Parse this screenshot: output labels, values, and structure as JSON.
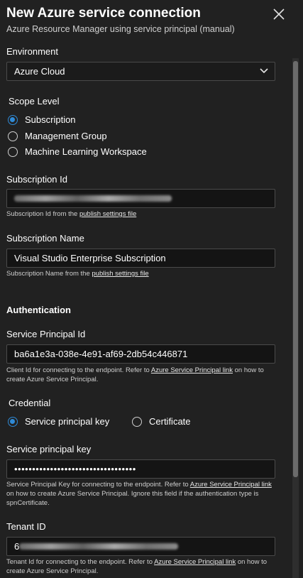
{
  "header": {
    "title": "New Azure service connection",
    "subtitle": "Azure Resource Manager using service principal (manual)"
  },
  "environment": {
    "label": "Environment",
    "value": "Azure Cloud"
  },
  "scope": {
    "label": "Scope Level",
    "options": [
      "Subscription",
      "Management Group",
      "Machine Learning Workspace"
    ],
    "selected": "Subscription"
  },
  "subscription_id": {
    "label": "Subscription Id",
    "help_prefix": "Subscription Id from the ",
    "help_link": "publish settings file"
  },
  "subscription_name": {
    "label": "Subscription Name",
    "value": "Visual Studio Enterprise Subscription",
    "help_prefix": "Subscription Name from the ",
    "help_link": "publish settings file"
  },
  "authentication": {
    "heading": "Authentication"
  },
  "service_principal_id": {
    "label": "Service Principal Id",
    "value": "ba6a1e3a-038e-4e91-af69-2db54c446871",
    "help_prefix": "Client Id for connecting to the endpoint. Refer to ",
    "help_link": "Azure Service Principal link",
    "help_suffix": " on how to create Azure Service Principal."
  },
  "credential": {
    "label": "Credential",
    "options": [
      "Service principal key",
      "Certificate"
    ],
    "selected": "Service principal key"
  },
  "service_principal_key": {
    "label": "Service principal key",
    "value": "••••••••••••••••••••••••••••••••••",
    "help_prefix": "Service Principal Key for connecting to the endpoint. Refer to ",
    "help_link": "Azure Service Principal link",
    "help_suffix": " on how to create Azure Service Principal. Ignore this field if the authentication type is spnCertificate."
  },
  "tenant_id": {
    "label": "Tenant ID",
    "value_prefix": "6",
    "help_prefix": "Tenant Id for connecting to the endpoint. Refer to ",
    "help_link": "Azure Service Principal link",
    "help_suffix": " on how to create Azure Service Principal."
  },
  "icons": {
    "close": "close-icon",
    "dropdown": "chevron-down-icon"
  },
  "colors": {
    "background": "#212121",
    "accent": "#2f8ad6",
    "input_bg": "#141414"
  }
}
